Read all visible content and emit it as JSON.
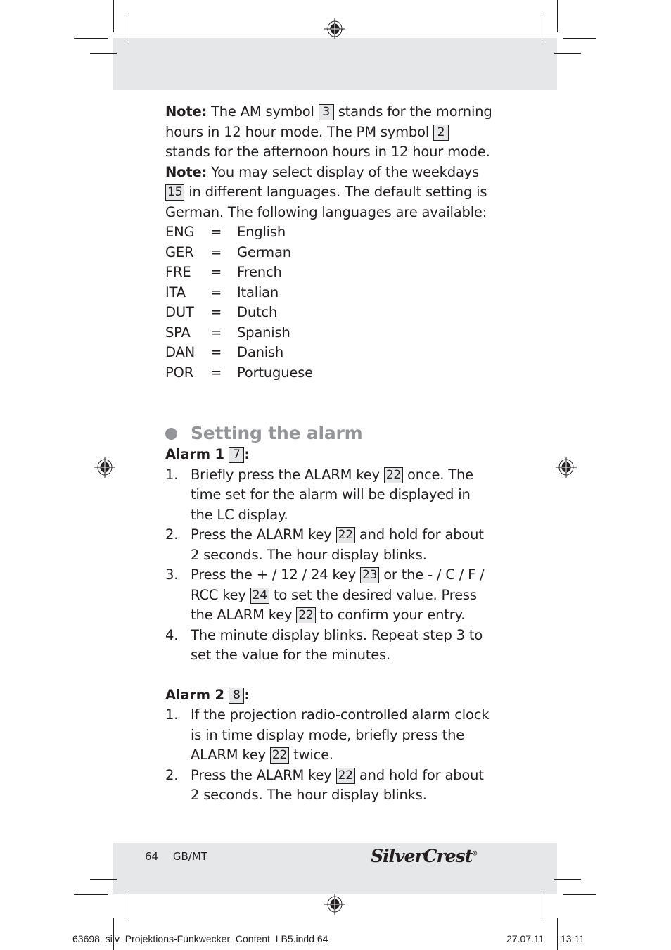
{
  "note1": {
    "label": "Note:",
    "parts": [
      "The AM symbol",
      "3",
      "stands for the morning hours in 12 hour mode. The PM symbol",
      "2",
      "stands for the afternoon hours in 12 hour mode."
    ]
  },
  "note2": {
    "label": "Note:",
    "parts": [
      "You may select display of the weekdays",
      "15",
      "in different languages. The default setting is German. The following languages are available:"
    ]
  },
  "languages": [
    {
      "code": "ENG",
      "eq": "=",
      "name": "English"
    },
    {
      "code": "GER",
      "eq": "=",
      "name": "German"
    },
    {
      "code": "FRE",
      "eq": "=",
      "name": "French"
    },
    {
      "code": "ITA",
      "eq": "=",
      "name": "Italian"
    },
    {
      "code": "DUT",
      "eq": "=",
      "name": "Dutch"
    },
    {
      "code": "SPA",
      "eq": "=",
      "name": "Spanish"
    },
    {
      "code": "DAN",
      "eq": "=",
      "name": "Danish"
    },
    {
      "code": "POR",
      "eq": "=",
      "name": "Portuguese"
    }
  ],
  "section": {
    "title": "Setting the alarm"
  },
  "alarm1": {
    "label": "Alarm 1",
    "ref": "7",
    "colon": ":",
    "steps": [
      {
        "num": "1.",
        "parts": [
          "Briefly press the ALARM key",
          "22",
          "once. The time set for the alarm will be displayed in the LC display."
        ]
      },
      {
        "num": "2.",
        "parts": [
          "Press the ALARM key",
          "22",
          "and hold for about 2 seconds. The hour display blinks."
        ]
      },
      {
        "num": "3.",
        "parts": [
          "Press the + / 12 / 24 key",
          "23",
          "or the - / C / F / RCC key",
          "24",
          "to set the desired value. Press the ALARM key",
          "22",
          "to confirm your entry."
        ]
      },
      {
        "num": "4.",
        "parts": [
          "The minute display blinks. Repeat step 3 to set the value for the minutes."
        ]
      }
    ]
  },
  "alarm2": {
    "label": "Alarm 2",
    "ref": "8",
    "colon": ":",
    "steps": [
      {
        "num": "1.",
        "parts": [
          "If the projection radio-controlled alarm clock is in time display mode, briefly press the ALARM key",
          "22",
          "twice."
        ]
      },
      {
        "num": "2.",
        "parts": [
          "Press the ALARM key",
          "22",
          "and hold for about 2 seconds. The hour display blinks."
        ]
      }
    ]
  },
  "footer": {
    "page_number": "64",
    "locale": "GB/MT",
    "brand": "SilverCrest",
    "registered": "®"
  },
  "slug": {
    "file": "63698_silv_Projektions-Funkwecker_Content_LB5.indd   64",
    "date": "27.07.11",
    "time": "13:11"
  },
  "colors": {
    "band_gray": "#e6e7e8",
    "heading_gray": "#939598",
    "text": "#231f20"
  }
}
